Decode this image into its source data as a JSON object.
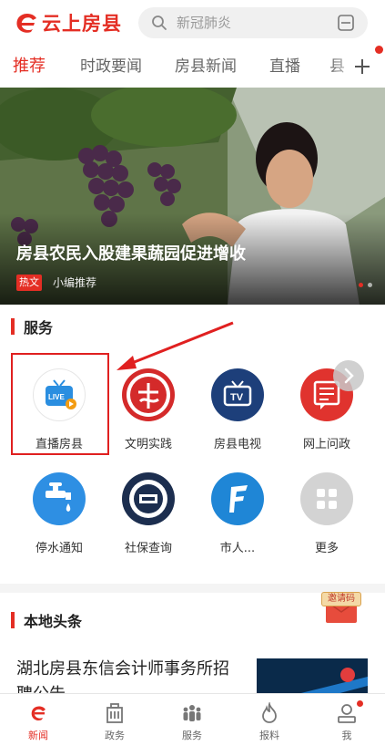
{
  "header": {
    "app_name": "云上房县",
    "search_placeholder": "新冠肺炎"
  },
  "tabs": [
    {
      "label": "推荐",
      "active": true
    },
    {
      "label": "时政要闻",
      "active": false
    },
    {
      "label": "房县新闻",
      "active": false
    },
    {
      "label": "直播",
      "active": false
    },
    {
      "label": "县",
      "active": false
    }
  ],
  "banner": {
    "title": "房县农民入股建果蔬园促进增收",
    "badge": "热文",
    "source": "小编推荐"
  },
  "services": {
    "title": "服务",
    "items": [
      {
        "label": "直播房县",
        "icon": "live-tv-icon"
      },
      {
        "label": "文明实践",
        "icon": "civilization-practice-icon"
      },
      {
        "label": "房县电视",
        "icon": "tv-icon"
      },
      {
        "label": "网上问政",
        "icon": "online-inquiry-icon"
      },
      {
        "label": "停水通知",
        "icon": "water-tap-icon"
      },
      {
        "label": "社保查询",
        "icon": "social-security-icon"
      },
      {
        "label": "市人...",
        "icon": "city-people-icon"
      },
      {
        "label": "更多",
        "icon": "more-grid-icon"
      }
    ]
  },
  "local_news": {
    "title": "本地头条",
    "invite_label": "邀请码",
    "items": [
      {
        "title": "湖北房县东信会计师事务所招聘公告"
      }
    ]
  },
  "bottom_nav": [
    {
      "label": "新闻",
      "active": true
    },
    {
      "label": "政务",
      "active": false
    },
    {
      "label": "服务",
      "active": false
    },
    {
      "label": "报料",
      "active": false
    },
    {
      "label": "我",
      "active": false
    }
  ],
  "colors": {
    "brand_red": "#e42e24",
    "annotation_red": "#e02020"
  }
}
